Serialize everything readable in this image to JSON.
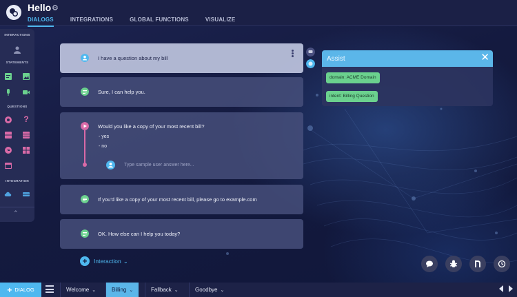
{
  "header": {
    "title": "Hello",
    "tabs": [
      {
        "label": "DIALOGS",
        "active": true
      },
      {
        "label": "INTEGRATIONS",
        "active": false
      },
      {
        "label": "GLOBAL FUNCTIONS",
        "active": false
      },
      {
        "label": "VISUALIZE",
        "active": false
      }
    ]
  },
  "toolbar": {
    "interactions_label": "INTERACTIONS",
    "statements_label": "STATEMENTS",
    "questions_label": "QUESTIONS",
    "integration_label": "INTEGRATION"
  },
  "dialog": {
    "user_message": "I have a question about my bill",
    "bot_reply": "Sure, I can help you.",
    "question": "Would you like a copy of your most recent bill?",
    "options": [
      "- yes",
      "- no"
    ],
    "sample_placeholder": "Type sample user answer here...",
    "statement_link": "If you'd like a copy of your most recent bill, please go to example.com",
    "closing": "OK. How else can I help you today?",
    "add_interaction_label": "Interaction"
  },
  "assist": {
    "title": "Assist",
    "close": "✕",
    "chips": [
      "domain: ACME Domain",
      "intent: Billing Question"
    ]
  },
  "footer": {
    "add_dialog_label": "DIALOG",
    "tabs": [
      {
        "label": "Welcome",
        "active": false
      },
      {
        "label": "Billing",
        "active": true
      },
      {
        "label": "Fallback",
        "active": false
      },
      {
        "label": "Goodbye",
        "active": false
      }
    ]
  },
  "colors": {
    "accent": "#4fb8ef",
    "statement": "#6bd18e",
    "question": "#d96aa7",
    "chip": "#6bd18e"
  }
}
